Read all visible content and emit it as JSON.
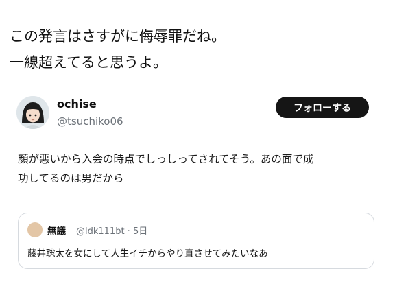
{
  "caption": {
    "line1": "この発言はさすがに侮辱罪だね。",
    "line2": "一線超えてると思うよ。"
  },
  "tweet": {
    "display_name": "ochise",
    "handle": "@tsuchiko06",
    "follow_label": "フォローする",
    "text_line1": "顔が悪いから入会の時点でしっしってされてそう。あの面で成",
    "text_line2": "功してるのは男だから",
    "avatar_icon": "cartoon-girl-avatar"
  },
  "quoted_tweet": {
    "display_name": "無議",
    "meta": "@ldk111bt · 5日",
    "text": "藤井聡太を女にして人生イチからやり直させてみたいなあ",
    "avatar_icon": "beige-circle-avatar"
  },
  "colors": {
    "follow_button_bg": "#151515",
    "follow_button_text": "#ffffff",
    "handle_gray": "#6b7178",
    "quote_border": "#d6dadf"
  }
}
